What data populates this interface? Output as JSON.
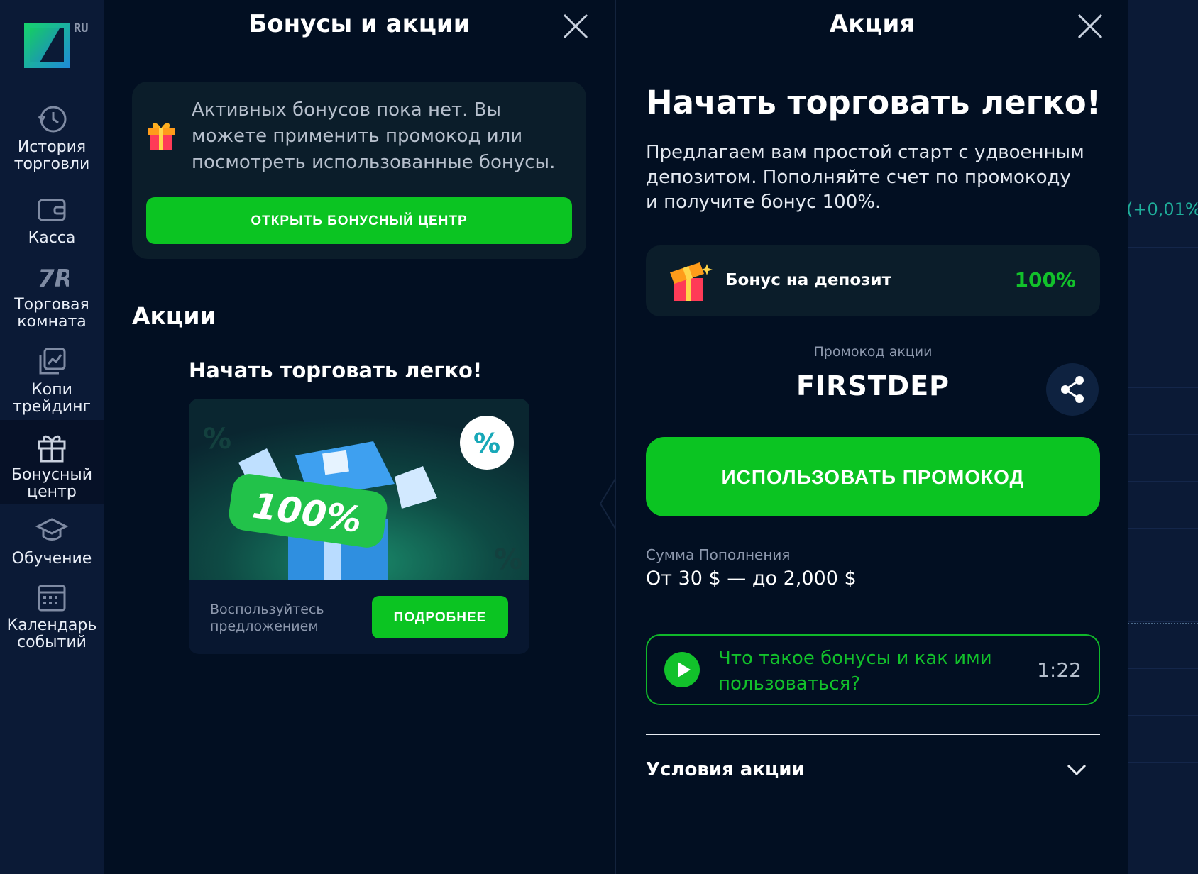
{
  "sidebar": {
    "logo_badge": "RU",
    "items": [
      {
        "line1": "История",
        "line2": "торговли",
        "icon": "history-icon"
      },
      {
        "line1": "Касса",
        "line2": "",
        "icon": "wallet-icon"
      },
      {
        "line1": "Торговая",
        "line2": "комната",
        "icon": "trading-room-icon"
      },
      {
        "line1": "Копи",
        "line2": "трейдинг",
        "icon": "copy-trading-icon"
      },
      {
        "line1": "Бонусный",
        "line2": "центр",
        "icon": "gift-icon"
      },
      {
        "line1": "Обучение",
        "line2": "",
        "icon": "graduation-cap-icon"
      },
      {
        "line1": "Календарь",
        "line2": "событий",
        "icon": "calendar-icon"
      }
    ]
  },
  "left_panel": {
    "title": "Бонусы и акции",
    "notice": {
      "text": "Активных бонусов пока нет. Вы можете применить промокод или посмотреть использованные бонусы.",
      "button": "ОТКРЫТЬ БОНУСНЫЙ ЦЕНТР"
    },
    "section_title": "Акции",
    "promo": {
      "title": "Начать торговать легко!",
      "image_badge": "100%",
      "description_line1": "Воспользуйтесь",
      "description_line2": "предложением",
      "button": "ПОДРОБНЕЕ"
    }
  },
  "right_panel": {
    "title": "Акция",
    "heading": "Начать торговать легко!",
    "description": "Предлагаем вам простой старт с удвоенным депозитом. Пополняйте счет по промокоду и получите бонус 100%.",
    "bonus": {
      "label": "Бонус на депозит",
      "value": "100%"
    },
    "promo_caption": "Промокод акции",
    "promo_code": "FIRSTDEP",
    "use_button": "ИСПОЛЬЗОВАТЬ ПРОМОКОД",
    "sum_caption": "Сумма Пополнения",
    "sum_value": "От 30 $ — до 2,000 $",
    "video": {
      "text": "Что такое бонусы и как ими пользоваться?",
      "duration": "1:22"
    },
    "terms": "Условия акции"
  },
  "background": {
    "ticker": "(+0,01%"
  },
  "colors": {
    "accent_green": "#0bc422",
    "panel_bg": "#020f22",
    "sidebar_bg": "#0b1a36",
    "ticker_teal": "#1fae9a"
  }
}
